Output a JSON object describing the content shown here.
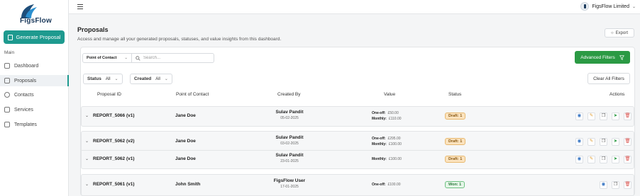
{
  "sidebar": {
    "logo_text": "FigsFlow",
    "generate_label": "Generate Proposal",
    "section_label": "Main",
    "items": [
      {
        "label": "Dashboard",
        "icon": "dashboard-icon"
      },
      {
        "label": "Proposals",
        "icon": "document-icon",
        "active": true
      },
      {
        "label": "Contacts",
        "icon": "contacts-icon"
      },
      {
        "label": "Services",
        "icon": "services-icon"
      },
      {
        "label": "Templates",
        "icon": "templates-icon"
      }
    ]
  },
  "topbar": {
    "org_name": "FigsFlow Limited"
  },
  "main": {
    "title": "Proposals",
    "subtitle": "Access and manage all your generated proposals, statuses, and value insights from this dashboard.",
    "export_label": "Export",
    "search": {
      "filter_label": "Point of Contact",
      "placeholder": "Search..."
    },
    "advanced_filters_label": "Advanced Filters",
    "filters": {
      "status_label": "Status",
      "status_value": "All",
      "created_label": "Created",
      "created_value": "All",
      "clear_label": "Clear All Filters"
    },
    "columns": [
      "Proposal ID",
      "Point of Contact",
      "Created By",
      "Value",
      "Status",
      "Actions"
    ],
    "rows": [
      {
        "id": "REPORT_5066 (v1)",
        "contact": "Jane Doe",
        "creator": "Sulav Pandit",
        "date": "05-02-2025",
        "value_lines": [
          {
            "label": "One-off:",
            "amount": "£50.00"
          },
          {
            "label": "Monthly:",
            "amount": "£110.00"
          }
        ],
        "status": "Draft: 1"
      },
      {
        "id": "REPORT_5062 (v2)",
        "contact": "Jane Doe",
        "creator": "Sulav Pandit",
        "date": "03-02-2025",
        "value_lines": [
          {
            "label": "One-off:",
            "amount": "£295.00"
          },
          {
            "label": "Monthly:",
            "amount": "£100.00"
          }
        ],
        "status": "Draft: 1"
      },
      {
        "id": "REPORT_5062 (v1)",
        "contact": "Jane Doe",
        "creator": "Sulav Pandit",
        "date": "23-01-2025",
        "value_lines": [
          {
            "label": "Monthly:",
            "amount": "£100.00"
          }
        ],
        "status": "Draft: 1"
      },
      {
        "id": "REPORT_5061 (v1)",
        "contact": "John Smith",
        "creator": "FigsFlow User",
        "date": "17-01-2025",
        "value_lines": [
          {
            "label": "One-off:",
            "amount": "£100.00"
          }
        ],
        "status": "Won: 1"
      }
    ]
  },
  "colors": {
    "brand": "#1e9a8f",
    "primary_green": "#2b9a44",
    "draft_bg": "#fbe3bf",
    "won_bg": "#e5f6e8",
    "logo_navy": "#1b3a5c"
  }
}
